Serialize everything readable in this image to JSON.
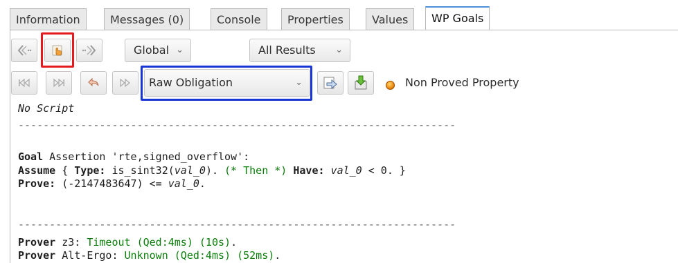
{
  "tabs": [
    {
      "label": "Information",
      "active": false
    },
    {
      "label": "Messages (0)",
      "active": false
    },
    {
      "label": "Console",
      "active": false
    },
    {
      "label": "Properties",
      "active": false
    },
    {
      "label": "Values",
      "active": false
    },
    {
      "label": "WP Goals",
      "active": true
    }
  ],
  "toolbar1": {
    "scope_select": "Global",
    "results_select": "All Results",
    "icons": [
      "previous-icon",
      "hand-pointer-icon",
      "next-icon"
    ]
  },
  "toolbar2": {
    "icons": [
      "first-icon",
      "last-icon",
      "undo-icon",
      "play-icon",
      "fast-forward-icon",
      "save-icon"
    ],
    "view_select": "Raw Obligation",
    "status_color": "#e67d00",
    "status_text": "Non Proved Property"
  },
  "content": {
    "script_status": "No Script",
    "separator": "----------------------------------------------------------------------",
    "goal": {
      "kw_goal": "Goal",
      "goal_rest": " Assertion 'rte,signed_overflow':",
      "kw_assume": "Assume",
      "assume_open": " { ",
      "kw_type": "Type:",
      "type_expr_1": " is_sint32(",
      "type_var": "val_0",
      "type_expr_2": "). ",
      "comment": "(* Then *)",
      "space": " ",
      "kw_have": "Have:",
      "have_space": " ",
      "have_var": "val_0",
      "have_rest": " < 0. }",
      "kw_prove": "Prove:",
      "prove_expr": " (-2147483647) <= ",
      "prove_var": "val_0",
      "prove_end": "."
    },
    "provers": [
      {
        "kw": "Prover",
        "name": " z3: ",
        "result": "Timeout (Qed:4ms) (10s)",
        "end": "."
      },
      {
        "kw": "Prover",
        "name": " Alt-Ergo: ",
        "result": "Unknown (Qed:4ms) (52ms)",
        "end": "."
      }
    ]
  }
}
